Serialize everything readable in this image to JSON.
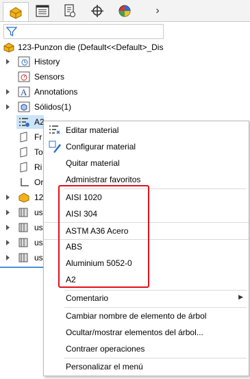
{
  "tabs": [
    {
      "name": "feature-manager-tab",
      "icon": "feature-manager-icon"
    },
    {
      "name": "property-manager-tab",
      "icon": "property-manager-icon"
    },
    {
      "name": "configuration-manager-tab",
      "icon": "configuration-manager-icon"
    },
    {
      "name": "dimxpert-manager-tab",
      "icon": "target-icon"
    },
    {
      "name": "display-manager-tab",
      "icon": "display-manager-icon"
    }
  ],
  "tree": {
    "root_label": "123-Punzon die  (Default<<Default>_Dis",
    "items": [
      {
        "label": "History"
      },
      {
        "label": "Sensors"
      },
      {
        "label": "Annotations"
      },
      {
        "label": "Sólidos(1)"
      },
      {
        "label": "A2"
      },
      {
        "label": "Fr"
      },
      {
        "label": "To"
      },
      {
        "label": "Ri"
      },
      {
        "label": "Or"
      },
      {
        "label": "12"
      },
      {
        "label": "us"
      },
      {
        "label": "us"
      },
      {
        "label": "us"
      },
      {
        "label": "us"
      }
    ]
  },
  "menu": {
    "top": [
      {
        "label": "Editar material"
      },
      {
        "label": "Configurar material"
      },
      {
        "label": "Quitar material"
      },
      {
        "label": "Administrar favoritos"
      }
    ],
    "favorites": [
      {
        "label": "AISI 1020"
      },
      {
        "label": "AISI 304"
      },
      {
        "label": "ASTM A36 Acero"
      },
      {
        "label": "ABS"
      },
      {
        "label": "Aluminium 5052-0"
      },
      {
        "label": "A2"
      }
    ],
    "comment": {
      "label": "Comentario"
    },
    "bottom": [
      {
        "label": "Cambiar nombre de elemento de árbol"
      },
      {
        "label": "Ocultar/mostrar elementos del árbol..."
      },
      {
        "label": "Contraer operaciones"
      }
    ],
    "customize": {
      "label": "Personalizar el menú"
    }
  },
  "colors": {
    "highlight_box": "#e0101a",
    "selection": "#cce4f7"
  }
}
